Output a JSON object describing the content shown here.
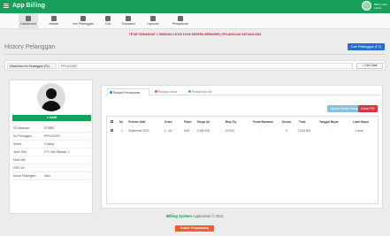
{
  "app": {
    "title": "App Billing"
  },
  "user": {
    "name": "Billing User",
    "role": "Admin"
  },
  "menu": [
    {
      "label": "Dashboard",
      "icon": "dashboard-icon"
    },
    {
      "label": "Master",
      "icon": "master-icon"
    },
    {
      "label": "Info Pelanggan",
      "icon": "users-icon"
    },
    {
      "label": "Tool",
      "icon": "tool-icon"
    },
    {
      "label": "Transaksi",
      "icon": "transaction-icon"
    },
    {
      "label": "Laporan",
      "icon": "report-icon"
    },
    {
      "label": "Pengaturan",
      "icon": "settings-icon"
    }
  ],
  "warning": "TETAP SEMANGAT !! SEMOGA COVID 19 INI SEGERA BERAKHIR | PELANGGAN SATUAN 1933",
  "page": {
    "title": "History Pelanggan",
    "search_button": "Cari Pelanggan (F2)"
  },
  "search": {
    "label": "Masukkan No Pelanggan (F1)",
    "value": "PPKU22097",
    "button": "Cek Data"
  },
  "profile": {
    "status": "Aktif",
    "rows": [
      {
        "label": "ID Database",
        "value": "873885"
      },
      {
        "label": "No Pelanggan",
        "value": "PPKU22097"
      },
      {
        "label": "Status",
        "value": "0 Aktifg"
      },
      {
        "label": "Jenis Tarif",
        "value": "FTC Mitr Standar 1"
      },
      {
        "label": "Merk Wifi",
        "value": ""
      },
      {
        "label": "SSID Wi",
        "value": ""
      },
      {
        "label": "Nama Pelanggan",
        "value": "Joko"
      }
    ]
  },
  "tabs": [
    "Riwayat Pembayaran",
    "Riwayat Online",
    "Riwayat Bon Air"
  ],
  "buttons": {
    "update": "Update Sheep Riwayat",
    "pdf": "Cetak PDF"
  },
  "table": {
    "headers": [
      "No",
      "Periode Nilai",
      "Grant",
      "Paket",
      "Harga Air",
      "Biay Tip",
      "PowerBanasan",
      "Denda",
      "Total",
      "Tanggal Bayar",
      "Label Bayar"
    ],
    "rows": [
      [
        "1",
        "September 2022",
        "0 - 4H",
        "SAR",
        "2.486.000",
        "22.000",
        "-",
        "0",
        "2.524.000",
        "-",
        "Lunas"
      ]
    ]
  },
  "footer": {
    "brand": "Billing System",
    "suffix": " Application © 2021",
    "support": "Dukuh Tenpanbang"
  }
}
